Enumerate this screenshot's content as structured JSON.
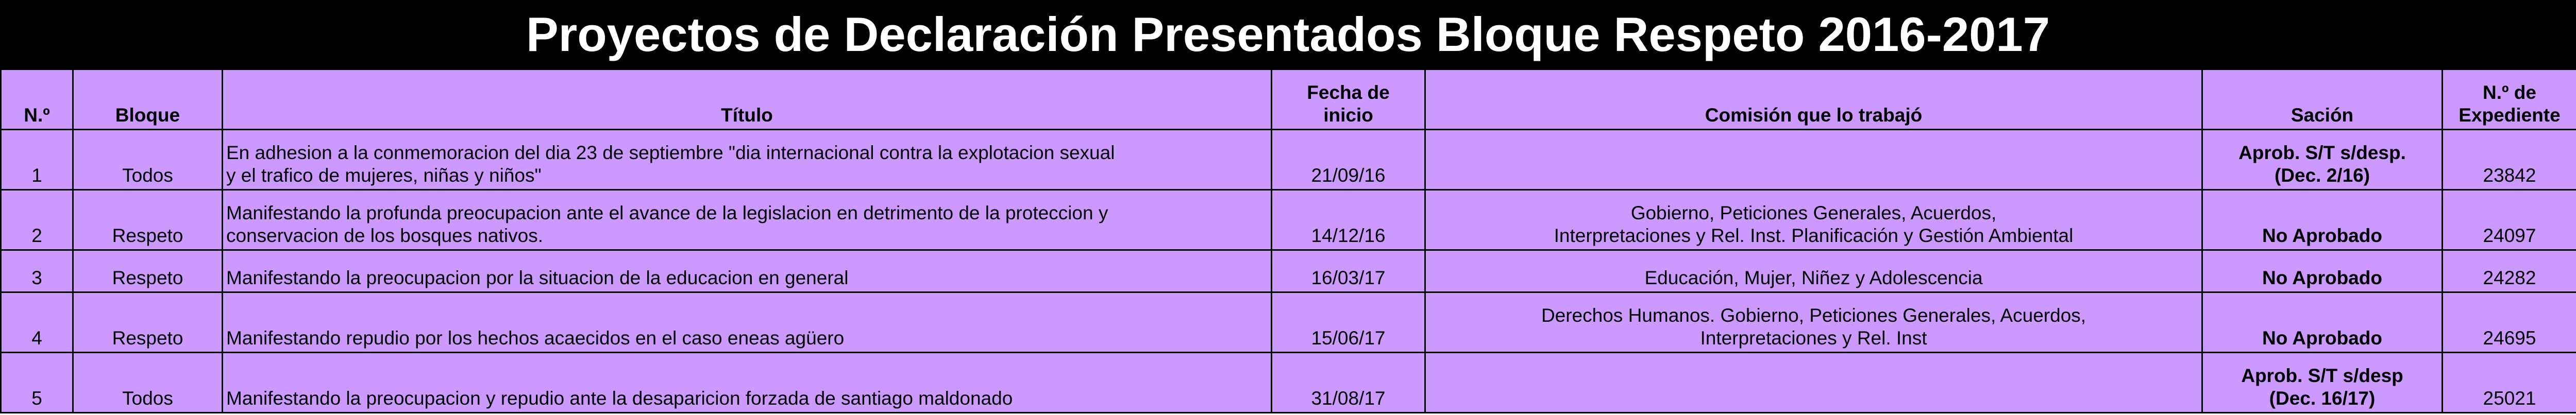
{
  "title": "Proyectos de Declaración Presentados Bloque Respeto 2016-2017",
  "headers": {
    "num": "N.º",
    "bloque": "Bloque",
    "titulo": "Título",
    "fecha_line1": "Fecha de",
    "fecha_line2": "inicio",
    "comision": "Comisión que lo trabajó",
    "sancion": "Sación",
    "exp_line1": "N.º de",
    "exp_line2": "Expediente"
  },
  "rows": [
    {
      "num": "1",
      "bloque": "Todos",
      "titulo_line1": "En adhesion a la conmemoracion del dia 23 de septiembre \"dia internacional contra la explotacion sexual",
      "titulo_line2": "y el trafico de mujeres, niñas y   niños\"",
      "fecha": "21/09/16",
      "comision_line1": "",
      "comision_line2": "",
      "sancion_line1": "Aprob. S/T s/desp.",
      "sancion_line2": "(Dec. 2/16)",
      "sancion_color": "#000000",
      "expediente": "23842"
    },
    {
      "num": "2",
      "bloque": "Respeto",
      "titulo_line1": "Manifestando la profunda preocupacion ante el avance de la legislacion en detrimento de la proteccion y",
      "titulo_line2": "conservacion de los bosques  nativos.",
      "fecha": "14/12/16",
      "comision_line1": "Gobierno, Peticiones Generales, Acuerdos,",
      "comision_line2": "Interpretaciones y Rel. Inst. Planificación y Gestión Ambiental",
      "sancion_line1": "",
      "sancion_line2": "No Aprobado",
      "sancion_color": "#ff0000",
      "expediente": "24097"
    },
    {
      "num": "3",
      "bloque": "Respeto",
      "titulo_line1": "Manifestando la preocupacion por la situacion de la   educacion en general",
      "titulo_line2": "",
      "fecha": "16/03/17",
      "comision_line1": "Educación, Mujer, Niñez y Adolescencia",
      "comision_line2": "",
      "sancion_line1": "No Aprobado",
      "sancion_line2": "",
      "sancion_color": "#ff0000",
      "expediente": "24282"
    },
    {
      "num": "4",
      "bloque": "Respeto",
      "titulo_line1": "Manifestando repudio por los hechos acaecidos en el caso  eneas agüero",
      "titulo_line2": "",
      "fecha": "15/06/17",
      "comision_line1": "Derechos Humanos. Gobierno, Peticiones Generales, Acuerdos,",
      "comision_line2": "Interpretaciones y Rel. Inst",
      "sancion_line1": "",
      "sancion_line2": "No Aprobado",
      "sancion_color": "#ff0000",
      "expediente": "24695"
    },
    {
      "num": "5",
      "bloque": "Todos",
      "titulo_line1": "Manifestando la preocupacion y repudio ante la  desaparicion forzada de santiago maldonado",
      "titulo_line2": "",
      "fecha": "31/08/17",
      "comision_line1": "",
      "comision_line2": "",
      "sancion_line1": "Aprob. S/T s/desp",
      "sancion_line2": "(Dec. 16/17)",
      "sancion_color": "#000000",
      "expediente": "25021"
    }
  ],
  "colors": {
    "title_bg": "#000000",
    "title_text": "#ffffff",
    "cell_bg": "#cc99ff",
    "border": "#000000",
    "not_approved": "#ff0000"
  }
}
